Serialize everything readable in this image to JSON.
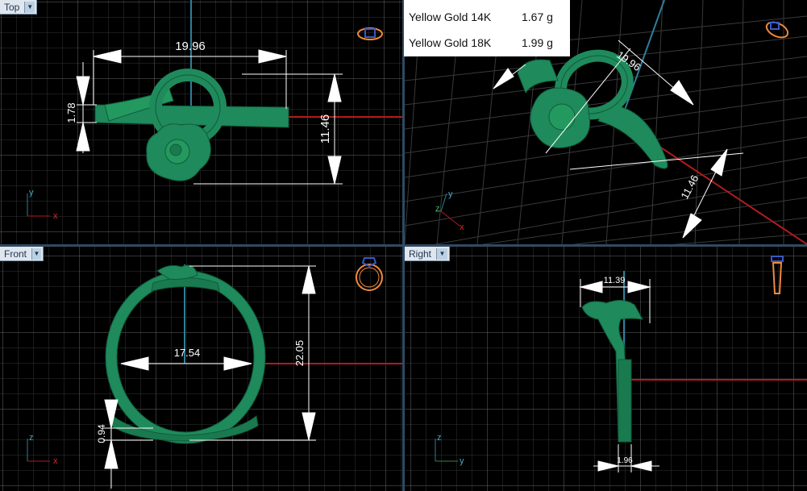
{
  "viewports": {
    "top": {
      "tab_label": "Top",
      "dimensions": {
        "width": "19.96",
        "height": "11.46",
        "thickness": "1.78"
      },
      "axes": {
        "vertical": "y",
        "horizontal": "x"
      }
    },
    "perspective": {
      "dimensions": {
        "width": "19.96",
        "height": "11.46"
      },
      "axes": {
        "vertical": "y",
        "depth": "z",
        "horizontal": "x"
      }
    },
    "front": {
      "tab_label": "Front",
      "dimensions": {
        "inner_diameter": "17.54",
        "outer_height": "22.05",
        "band_thickness": "0.94"
      },
      "axes": {
        "vertical": "z",
        "horizontal": "x"
      }
    },
    "right": {
      "tab_label": "Right",
      "dimensions": {
        "top_width": "11.39",
        "band_width": "1.96"
      },
      "axes": {
        "vertical": "z",
        "horizontal": "y"
      }
    }
  },
  "metal_weights": [
    {
      "metal": "Yellow Gold 14K",
      "weight": "1.67 g"
    },
    {
      "metal": "Yellow Gold 18K",
      "weight": "1.99 g"
    }
  ],
  "colors": {
    "model": "#1f8a5c",
    "model_dark": "#0f5c3a",
    "grid_minor": "#3a3a3a",
    "grid_major": "#6e6e6e",
    "axis_x": "#b01c1c",
    "axis_y": "#2d7f9a",
    "tab_bg": "#dfe6ee",
    "nav_icon": "#f08a3c"
  }
}
